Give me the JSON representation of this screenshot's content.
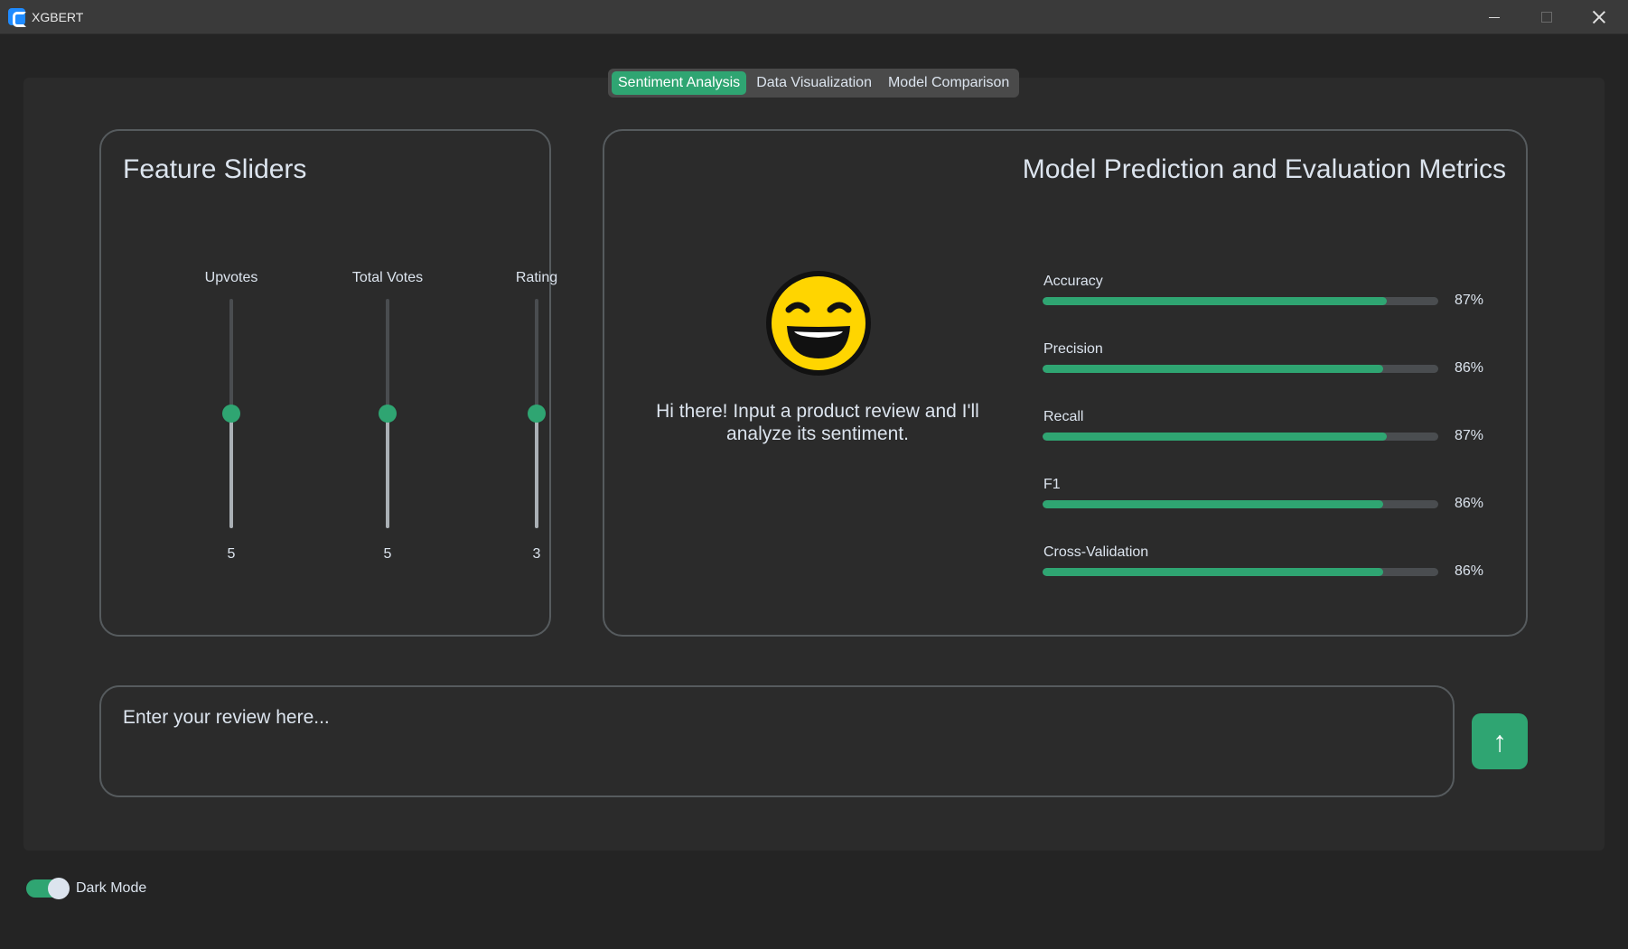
{
  "window": {
    "title": "XGBERT",
    "accent_color": "#2fa572"
  },
  "tabs": [
    {
      "label": "Sentiment Analysis",
      "active": true
    },
    {
      "label": "Data Visualization",
      "active": false
    },
    {
      "label": "Model Comparison",
      "active": false
    }
  ],
  "sliders_panel": {
    "title": "Feature Sliders",
    "sliders": [
      {
        "label": "Upvotes",
        "value": "5",
        "level": 0.5
      },
      {
        "label": "Total Votes",
        "value": "5",
        "level": 0.5
      },
      {
        "label": "Rating",
        "value": "3",
        "level": 0.5
      }
    ]
  },
  "metrics_panel": {
    "title": "Model Prediction and Evaluation Metrics",
    "emoji": "grinning-face-icon",
    "greeting": "Hi there! Input a product review and I'll analyze its sentiment.",
    "metrics": [
      {
        "label": "Accuracy",
        "pct": "87%",
        "value": 87
      },
      {
        "label": "Precision",
        "pct": "86%",
        "value": 86
      },
      {
        "label": "Recall",
        "pct": "87%",
        "value": 87
      },
      {
        "label": "F1",
        "pct": "86%",
        "value": 86
      },
      {
        "label": "Cross-Validation",
        "pct": "86%",
        "value": 86
      }
    ]
  },
  "review": {
    "placeholder": "Enter your review here...",
    "value": "",
    "submit_icon": "arrow-up-icon",
    "submit_glyph": "↑"
  },
  "footer": {
    "dark_mode_label": "Dark Mode",
    "dark_mode_on": true
  }
}
